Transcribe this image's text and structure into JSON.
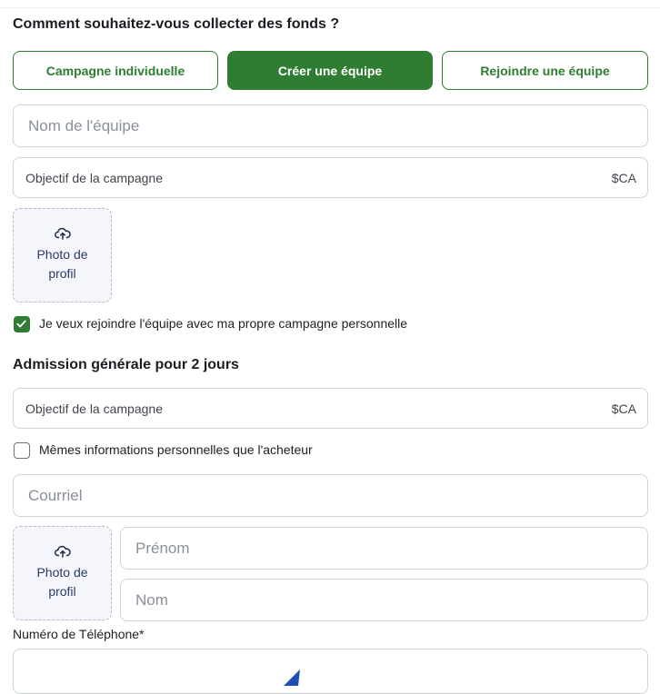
{
  "section1": {
    "heading": "Comment souhaitez-vous collecter des fonds ?",
    "options": [
      {
        "label": "Campagne individuelle",
        "active": false
      },
      {
        "label": "Créer une équipe",
        "active": true
      },
      {
        "label": "Rejoindre une équipe",
        "active": false
      }
    ],
    "team_name": {
      "placeholder": "Nom de l'équipe"
    },
    "goal": {
      "placeholder": "Objectif de la campagne",
      "suffix": "$CA"
    },
    "photo": {
      "line1": "Photo de",
      "line2": "profil",
      "icon": "cloud-upload-icon"
    },
    "join_checkbox": {
      "label": "Je veux rejoindre l'équipe avec ma propre campagne personnelle",
      "checked": true
    }
  },
  "section2": {
    "heading": "Admission générale pour 2 jours",
    "goal": {
      "placeholder": "Objectif de la campagne",
      "suffix": "$CA"
    },
    "same_info_checkbox": {
      "label": "Mêmes informations personnelles que l'acheteur",
      "checked": false
    },
    "email": {
      "placeholder": "Courriel"
    },
    "photo": {
      "line1": "Photo de",
      "line2": "profil",
      "icon": "cloud-upload-icon"
    },
    "first_name": {
      "placeholder": "Prénom"
    },
    "last_name": {
      "placeholder": "Nom"
    },
    "phone_label": "Numéro de Téléphone*"
  },
  "colors": {
    "accent": "#2e7d32",
    "border": "#cfd4da",
    "photo_bg": "#f4f6fb"
  }
}
